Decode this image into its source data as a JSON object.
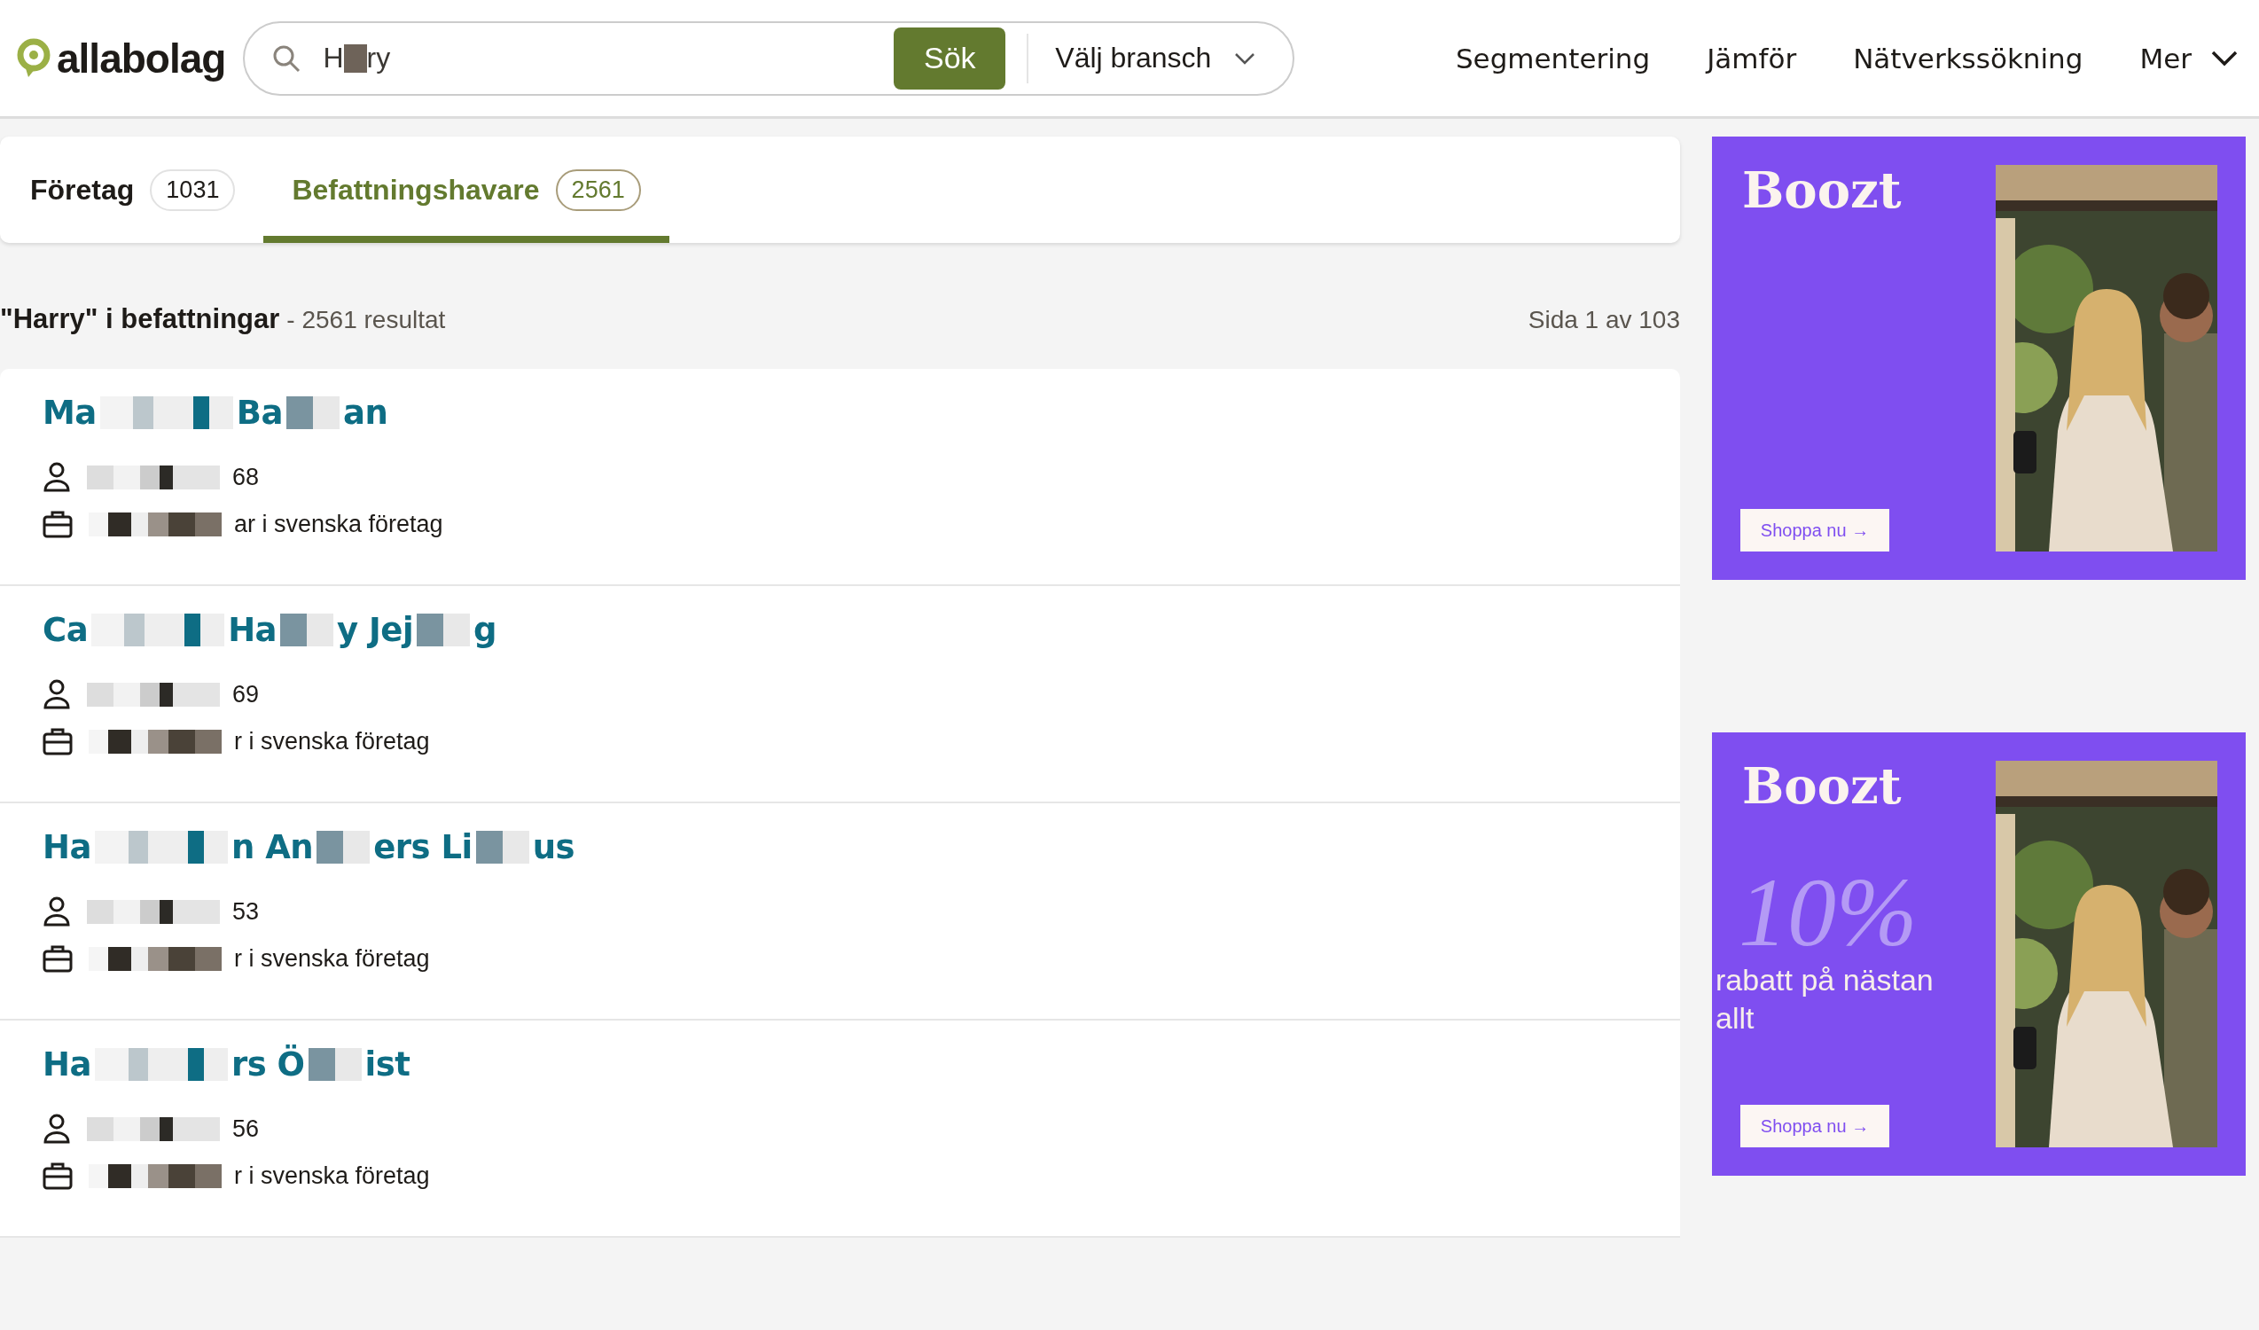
{
  "header": {
    "logo": "allabolag",
    "search": {
      "value_parts": [
        "H",
        "ry"
      ],
      "button": "Sök"
    },
    "industry_select": "Välj bransch",
    "nav": [
      "Segmentering",
      "Jämför",
      "Nätverkssökning",
      "Mer"
    ]
  },
  "tabs": [
    {
      "label": "Företag",
      "count": "1031",
      "selected": false
    },
    {
      "label": "Befattningshavare",
      "count": "2561",
      "selected": true
    }
  ],
  "summary": {
    "query": "\"Harry\" i befattningar",
    "count": "- 2561 resultat",
    "page": "Sida 1 av 103"
  },
  "results": [
    {
      "name_parts": [
        "Ma",
        "Ba",
        "an"
      ],
      "born": "68",
      "roles": "ar i svenska företag"
    },
    {
      "name_parts": [
        "Ca",
        "Ha",
        "y Jej",
        "g"
      ],
      "born": "69",
      "roles": "r i svenska företag"
    },
    {
      "name_parts": [
        "Ha",
        "n An",
        "ers Li",
        "us"
      ],
      "born": "53",
      "roles": "r i svenska företag"
    },
    {
      "name_parts": [
        "Ha",
        "rs Ö",
        "ist"
      ],
      "born": "56",
      "roles": "r i svenska företag"
    }
  ],
  "ads": [
    {
      "brand": "Boozt",
      "button": "Shoppa nu →"
    },
    {
      "brand": "Boozt",
      "offer": "10%",
      "offer_text": "rabatt på nästan allt",
      "button": "Shoppa nu →"
    }
  ]
}
